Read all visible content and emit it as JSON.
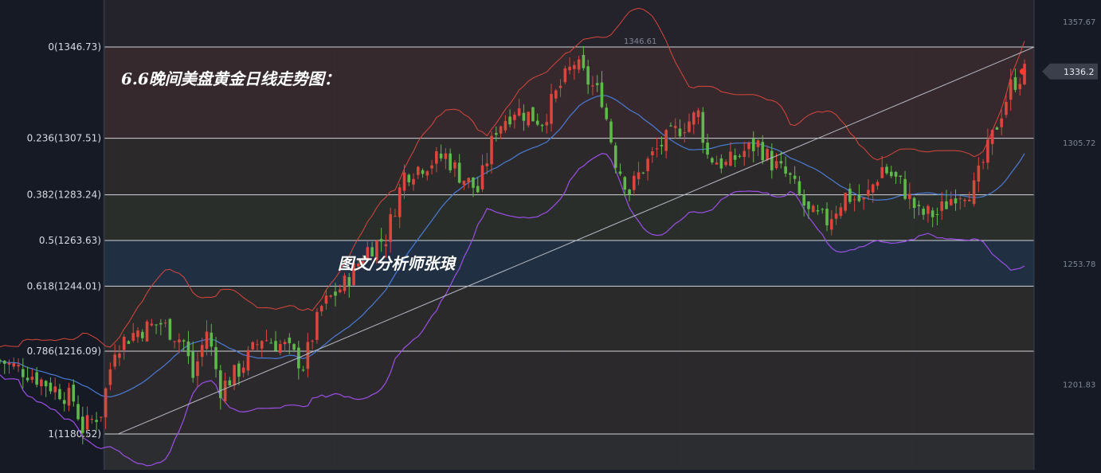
{
  "chart_data": {
    "type": "candlestick",
    "title": "6.6晚间美盘黄金日线走势图：",
    "watermark": "图文/分析师张琅",
    "price_high_label": "1346.61",
    "current_price": "1336.2",
    "y_range": [
      1165,
      1362
    ],
    "right_axis_ticks": [
      "1357.67",
      "1305.72",
      "1253.78",
      "1201.83"
    ],
    "right_axis_tick_values": [
      1357.67,
      1305.72,
      1253.78,
      1201.83
    ],
    "fib_levels": [
      {
        "label": "0(1346.73)",
        "ratio": 0,
        "price": 1346.73,
        "color": "#3a2a2e"
      },
      {
        "label": "0.236(1307.51)",
        "ratio": 0.236,
        "price": 1307.51,
        "color": "#2f2a2a"
      },
      {
        "label": "0.382(1283.24)",
        "ratio": 0.382,
        "price": 1283.24,
        "color": "#2b302b"
      },
      {
        "label": "0.5(1263.63)",
        "ratio": 0.5,
        "price": 1263.63,
        "color": "#213247"
      },
      {
        "label": "0.618(1244.01)",
        "ratio": 0.618,
        "price": 1244.01,
        "color": "#2e2c2b"
      },
      {
        "label": "0.786(1216.09)",
        "ratio": 0.786,
        "price": 1216.09,
        "color": "#2f2a2e"
      },
      {
        "label": "1(1180.52)",
        "ratio": 1,
        "price": 1180.52,
        "color": "#2f2f33"
      }
    ],
    "trendline": {
      "start": {
        "index": 18,
        "price": 1180.5
      },
      "end": {
        "index": 160,
        "price": 1346.7
      }
    },
    "colors": {
      "up": "#d9463c",
      "down": "#5fb94a",
      "upper_band": "#d9463c",
      "middle_band": "#4a7bd6",
      "lower_band": "#9b4fe6",
      "trendline": "#b8bcc6"
    }
  }
}
